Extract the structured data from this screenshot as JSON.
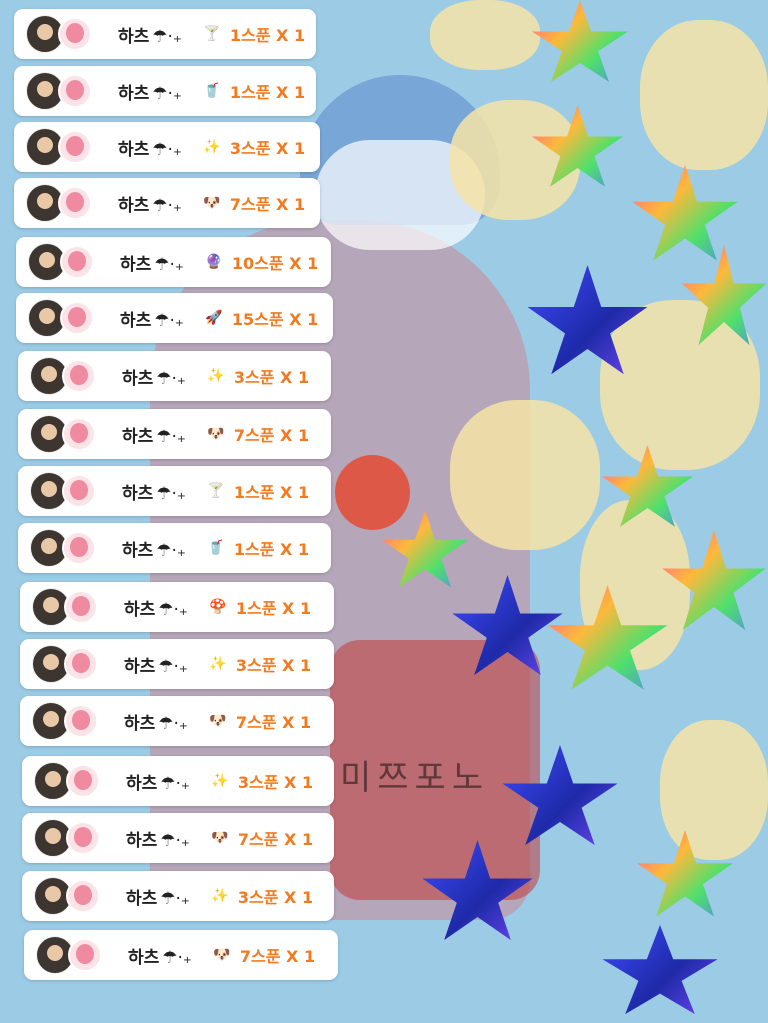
{
  "rows": [
    {
      "name": "하츠",
      "suffix": "☂︎·₊",
      "gift_icon": "cocktail-icon",
      "gift_glyph": "🍸",
      "amount": "1스푼 X 1"
    },
    {
      "name": "하츠",
      "suffix": "☂︎·₊",
      "gift_icon": "blue-drink-icon",
      "gift_glyph": "🥤",
      "amount": "1스푼 X 1"
    },
    {
      "name": "하츠",
      "suffix": "☂︎·₊",
      "gift_icon": "sparkle-stars-icon",
      "gift_glyph": "✨",
      "amount": "3스푼 X 1"
    },
    {
      "name": "하츠",
      "suffix": "☂︎·₊",
      "gift_icon": "puppy-icon",
      "gift_glyph": "🐶",
      "amount": "7스푼 X 1"
    },
    {
      "name": "하츠",
      "suffix": "☂︎·₊",
      "gift_icon": "snow-globe-icon",
      "gift_glyph": "🔮",
      "amount": "10스푼 X 1"
    },
    {
      "name": "하츠",
      "suffix": "☂︎·₊",
      "gift_icon": "rocket-icon",
      "gift_glyph": "🚀",
      "amount": "15스푼 X 1"
    },
    {
      "name": "하츠",
      "suffix": "☂︎·₊",
      "gift_icon": "sparkle-stars-icon",
      "gift_glyph": "✨",
      "amount": "3스푼 X 1"
    },
    {
      "name": "하츠",
      "suffix": "☂︎·₊",
      "gift_icon": "puppy-icon",
      "gift_glyph": "🐶",
      "amount": "7스푼 X 1"
    },
    {
      "name": "하츠",
      "suffix": "☂︎·₊",
      "gift_icon": "cocktail-icon",
      "gift_glyph": "🍸",
      "amount": "1스푼 X 1"
    },
    {
      "name": "하츠",
      "suffix": "☂︎·₊",
      "gift_icon": "blue-drink-icon",
      "gift_glyph": "🥤",
      "amount": "1스푼 X 1"
    },
    {
      "name": "하츠",
      "suffix": "☂︎·₊",
      "gift_icon": "mushroom-icon",
      "gift_glyph": "🍄",
      "amount": "1스푼 X 1"
    },
    {
      "name": "하츠",
      "suffix": "☂︎·₊",
      "gift_icon": "sparkle-stars-icon",
      "gift_glyph": "✨",
      "amount": "3스푼 X 1"
    },
    {
      "name": "하츠",
      "suffix": "☂︎·₊",
      "gift_icon": "puppy-icon",
      "gift_glyph": "🐶",
      "amount": "7스푼 X 1"
    },
    {
      "name": "하츠",
      "suffix": "☂︎·₊",
      "gift_icon": "sparkle-stars-icon",
      "gift_glyph": "✨",
      "amount": "3스푼 X 1"
    },
    {
      "name": "하츠",
      "suffix": "☂︎·₊",
      "gift_icon": "puppy-icon",
      "gift_glyph": "🐶",
      "amount": "7스푼 X 1"
    },
    {
      "name": "하츠",
      "suffix": "☂︎·₊",
      "gift_icon": "sparkle-stars-icon",
      "gift_glyph": "✨",
      "amount": "3스푼 X 1"
    },
    {
      "name": "하츠",
      "suffix": "☂︎·₊",
      "gift_icon": "puppy-icon",
      "gift_glyph": "🐶",
      "amount": "7스푼 X 1"
    }
  ],
  "background": {
    "shirt_text": "미쯔포노",
    "colors": {
      "sky": "#9ccbe6",
      "amount": "#f37a1f"
    }
  }
}
